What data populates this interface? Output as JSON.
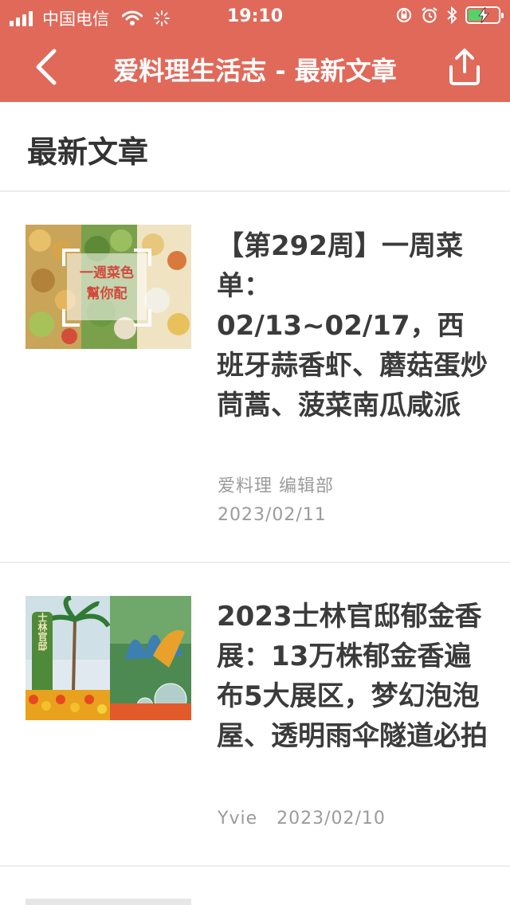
{
  "status_bar": {
    "carrier": "中国电信",
    "time": "19:10",
    "battery_level": 0.4
  },
  "navbar": {
    "title": "爱料理生活志 - 最新文章"
  },
  "section": {
    "title": "最新文章"
  },
  "articles": [
    {
      "title": "【第292周】一周菜单：02/13~02/17，西班牙蒜香虾、蘑菇蛋炒茼蒿、菠菜南瓜咸派",
      "author": "爱料理 编辑部",
      "date": "2023/02/11",
      "thumb_overlay_line1": "一週菜色",
      "thumb_overlay_line2": "幫你配"
    },
    {
      "title": "2023士林官邸郁金香展：13万株郁金香遍布5大展区，梦幻泡泡屋、透明雨伞隧道必拍",
      "author": "Yvie",
      "date": "2023/02/10",
      "thumb_sign": "士林官邸"
    }
  ],
  "colors": {
    "brand": "#e0695a",
    "divider": "#ececec",
    "meta_text": "#9b9b9b"
  },
  "icons": {
    "back": "chevron-left-icon",
    "share": "share-icon"
  }
}
